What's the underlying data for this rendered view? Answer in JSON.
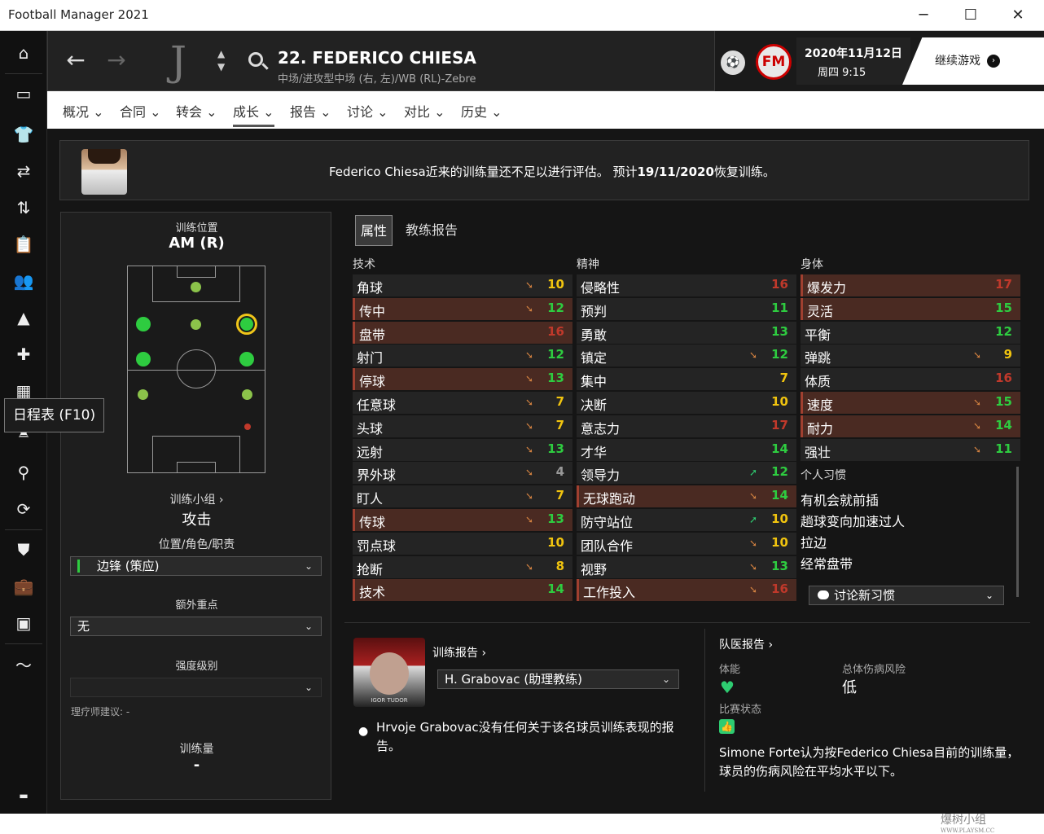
{
  "window": {
    "title": "Football Manager 2021",
    "minimize": "─",
    "maximize": "☐",
    "close": "✕"
  },
  "tooltip": "日程表 (F10)",
  "header": {
    "player_name": "22. FEDERICO CHIESA",
    "player_sub": "中场/进攻型中场 (右, 左)/WB (RL)-Zebre",
    "date": "2020年11月12日",
    "weekday": "周四 9:15",
    "continue_label": "继续游戏",
    "fm_logo": "FM"
  },
  "tabs": [
    "概况",
    "合同",
    "转会",
    "成长",
    "报告",
    "讨论",
    "对比",
    "历史"
  ],
  "notice": {
    "text_a": "Federico Chiesa近来的训练量还不足以进行评估。 预计",
    "text_date": "19/11/2020",
    "text_b": "恢复训练。"
  },
  "left": {
    "training_pos_label": "训练位置",
    "training_pos_value": "AM (R)",
    "group_label": "训练小组 ›",
    "group_value": "攻击",
    "role_label": "位置/角色/职责",
    "role_value": "边锋 (策应)",
    "extra_label": "额外重点",
    "extra_value": "无",
    "intensity_label": "强度级别",
    "physio_label": "理疗师建议: -",
    "workload_label": "训练量",
    "workload_value": "-"
  },
  "subtabs": {
    "attributes": "属性",
    "coach_report": "教练报告"
  },
  "columns": {
    "technical": "技术",
    "mental": "精神",
    "physical": "身体"
  },
  "technical": [
    {
      "name": "角球",
      "trend": "down",
      "value": "10",
      "color": "#f1c40f",
      "hl": false
    },
    {
      "name": "传中",
      "trend": "down",
      "value": "12",
      "color": "#2ecc40",
      "hl": true
    },
    {
      "name": "盘带",
      "trend": "",
      "value": "16",
      "color": "#c0392b",
      "hl": true
    },
    {
      "name": "射门",
      "trend": "down",
      "value": "12",
      "color": "#2ecc40",
      "hl": false
    },
    {
      "name": "停球",
      "trend": "down",
      "value": "13",
      "color": "#2ecc40",
      "hl": true
    },
    {
      "name": "任意球",
      "trend": "down",
      "value": "7",
      "color": "#f1c40f",
      "hl": false
    },
    {
      "name": "头球",
      "trend": "down",
      "value": "7",
      "color": "#f1c40f",
      "hl": false
    },
    {
      "name": "远射",
      "trend": "down",
      "value": "13",
      "color": "#2ecc40",
      "hl": false
    },
    {
      "name": "界外球",
      "trend": "down",
      "value": "4",
      "color": "#999999",
      "hl": false
    },
    {
      "name": "盯人",
      "trend": "down",
      "value": "7",
      "color": "#f1c40f",
      "hl": false
    },
    {
      "name": "传球",
      "trend": "down",
      "value": "13",
      "color": "#2ecc40",
      "hl": true
    },
    {
      "name": "罚点球",
      "trend": "",
      "value": "10",
      "color": "#f1c40f",
      "hl": false
    },
    {
      "name": "抢断",
      "trend": "down",
      "value": "8",
      "color": "#f1c40f",
      "hl": false
    },
    {
      "name": "技术",
      "trend": "",
      "value": "14",
      "color": "#2ecc40",
      "hl": true
    }
  ],
  "mental": [
    {
      "name": "侵略性",
      "trend": "",
      "value": "16",
      "color": "#c0392b",
      "hl": false
    },
    {
      "name": "预判",
      "trend": "",
      "value": "11",
      "color": "#2ecc40",
      "hl": false
    },
    {
      "name": "勇敢",
      "trend": "",
      "value": "13",
      "color": "#2ecc40",
      "hl": false
    },
    {
      "name": "镇定",
      "trend": "down",
      "value": "12",
      "color": "#2ecc40",
      "hl": false
    },
    {
      "name": "集中",
      "trend": "",
      "value": "7",
      "color": "#f1c40f",
      "hl": false
    },
    {
      "name": "决断",
      "trend": "",
      "value": "10",
      "color": "#f1c40f",
      "hl": false
    },
    {
      "name": "意志力",
      "trend": "",
      "value": "17",
      "color": "#c0392b",
      "hl": false
    },
    {
      "name": "才华",
      "trend": "",
      "value": "14",
      "color": "#2ecc40",
      "hl": false
    },
    {
      "name": "领导力",
      "trend": "up",
      "value": "12",
      "color": "#2ecc40",
      "hl": false
    },
    {
      "name": "无球跑动",
      "trend": "down",
      "value": "14",
      "color": "#2ecc40",
      "hl": true
    },
    {
      "name": "防守站位",
      "trend": "up",
      "value": "10",
      "color": "#f1c40f",
      "hl": false
    },
    {
      "name": "团队合作",
      "trend": "down",
      "value": "10",
      "color": "#f1c40f",
      "hl": false
    },
    {
      "name": "视野",
      "trend": "down",
      "value": "13",
      "color": "#2ecc40",
      "hl": false
    },
    {
      "name": "工作投入",
      "trend": "down",
      "value": "16",
      "color": "#c0392b",
      "hl": true
    }
  ],
  "physical": [
    {
      "name": "爆发力",
      "trend": "",
      "value": "17",
      "color": "#c0392b",
      "hl": true
    },
    {
      "name": "灵活",
      "trend": "",
      "value": "15",
      "color": "#2ecc40",
      "hl": true
    },
    {
      "name": "平衡",
      "trend": "",
      "value": "12",
      "color": "#2ecc40",
      "hl": false
    },
    {
      "name": "弹跳",
      "trend": "down",
      "value": "9",
      "color": "#f1c40f",
      "hl": false
    },
    {
      "name": "体质",
      "trend": "",
      "value": "16",
      "color": "#c0392b",
      "hl": false
    },
    {
      "name": "速度",
      "trend": "down",
      "value": "15",
      "color": "#2ecc40",
      "hl": true
    },
    {
      "name": "耐力",
      "trend": "down",
      "value": "14",
      "color": "#2ecc40",
      "hl": true
    },
    {
      "name": "强壮",
      "trend": "down",
      "value": "11",
      "color": "#2ecc40",
      "hl": false
    }
  ],
  "habits": {
    "title": "个人习惯",
    "items": [
      "有机会就前插",
      "趟球变向加速过人",
      "拉边",
      "经常盘带"
    ],
    "discuss_btn": "讨论新习惯"
  },
  "coach_report": {
    "title": "训练报告 ›",
    "coach_select": "H. Grabovac (助理教练)",
    "coach_photo_name": "IGOR TUDOR",
    "text": "Hrvoje Grabovac没有任何关于该名球员训练表现的报告。"
  },
  "medical": {
    "title": "队医报告 ›",
    "fitness_label": "体能",
    "injury_risk_label": "总体伤病风险",
    "injury_risk_value": "低",
    "match_label": "比赛状态",
    "text": "Simone Forte认为按Federico Chiesa目前的训练量，球员的伤病风险在平均水平以下。"
  },
  "watermark": {
    "text": "爆树小组",
    "url": "WWW.PLAYSM.CC"
  }
}
